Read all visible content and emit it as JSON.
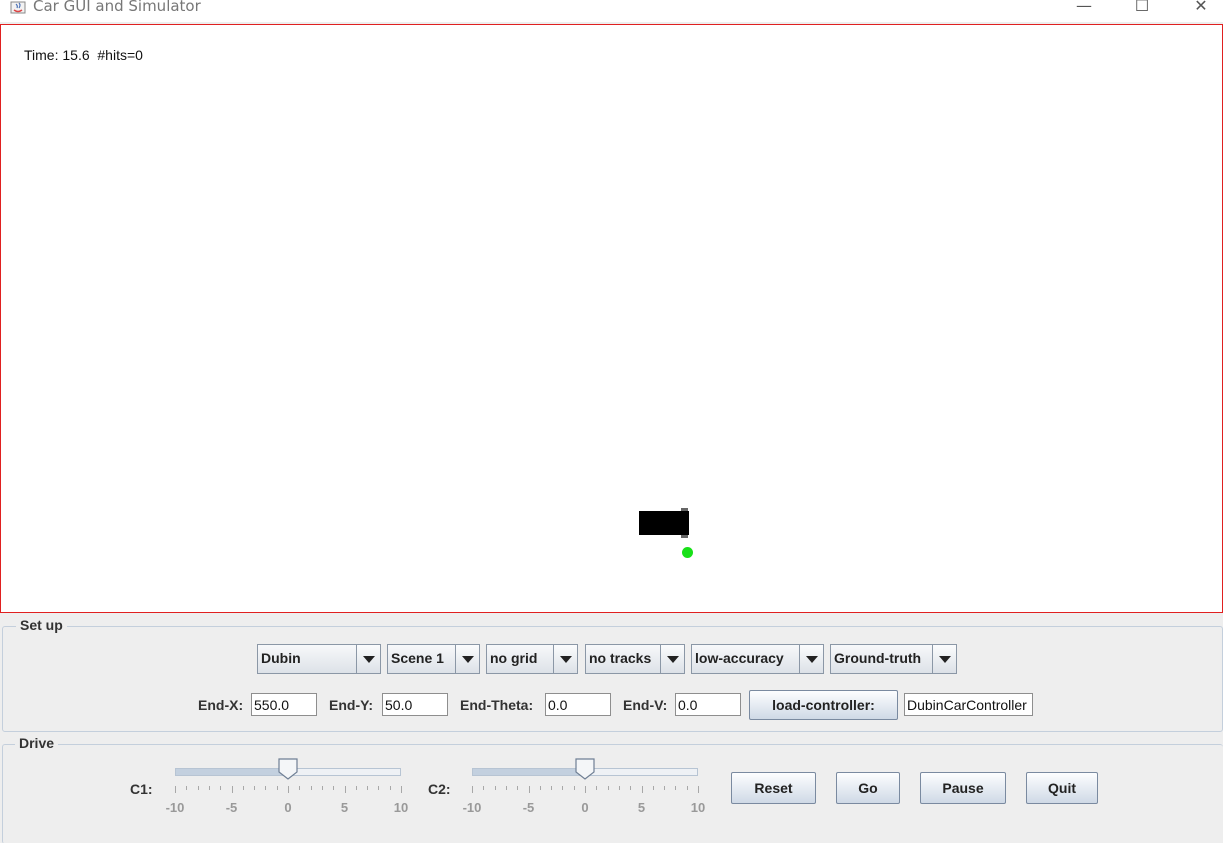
{
  "window": {
    "title": "Car GUI and Simulator",
    "minimize_glyph": "—",
    "maximize_glyph": "☐",
    "close_glyph": "✕"
  },
  "canvas": {
    "status_text": "Time: 15.6  #hits=0",
    "border_color": "#e02020",
    "car_color": "#000000",
    "goal_color": "#18e018"
  },
  "setup": {
    "title": "Set up",
    "combos": [
      {
        "value": "Dubin"
      },
      {
        "value": "Scene 1"
      },
      {
        "value": "no grid"
      },
      {
        "value": "no tracks"
      },
      {
        "value": "low-accuracy"
      },
      {
        "value": "Ground-truth"
      }
    ],
    "end_x": {
      "label": "End-X:",
      "value": "550.0"
    },
    "end_y": {
      "label": "End-Y:",
      "value": "50.0"
    },
    "end_theta": {
      "label": "End-Theta:",
      "value": "0.0"
    },
    "end_v": {
      "label": "End-V:",
      "value": "0.0"
    },
    "load_controller_label": "load-controller:",
    "controller_name": "DubinCarController"
  },
  "drive": {
    "title": "Drive",
    "sliders": [
      {
        "label": "C1:",
        "min": -10,
        "max": 10,
        "value": 0,
        "tick_labels": [
          "-10",
          "-5",
          "0",
          "5",
          "10"
        ]
      },
      {
        "label": "C2:",
        "min": -10,
        "max": 10,
        "value": 0,
        "tick_labels": [
          "-10",
          "-5",
          "0",
          "5",
          "10"
        ]
      }
    ],
    "buttons": {
      "reset": "Reset",
      "go": "Go",
      "pause": "Pause",
      "quit": "Quit"
    }
  }
}
